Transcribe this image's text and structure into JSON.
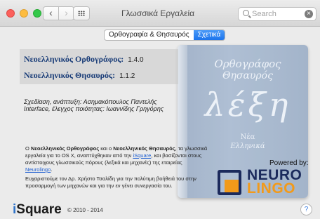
{
  "window": {
    "title": "Γλωσσικά Εργαλεία"
  },
  "search": {
    "placeholder": "Search"
  },
  "tabs": [
    {
      "label": "Ορθογραφία & Θησαυρός",
      "active": false
    },
    {
      "label": "Σχετικά",
      "active": true
    }
  ],
  "book": {
    "line1": "Ορθογράφος",
    "line2": "Θησαυρός",
    "word": "λέξη",
    "line4": "Νέα",
    "line5": "Ελληνικά"
  },
  "versions": [
    {
      "name": "Νεοελληνικός Ορθογράφος:",
      "version": "1.4.0"
    },
    {
      "name": "Νεοελληνικός Θησαυρός:",
      "version": "1.1.2"
    }
  ],
  "credits": {
    "design_label": "Σχεδίαση, ανάπτυξη:",
    "design_name": "Ασημακόπουλος Παντελής",
    "interface_label": "Interface, έλεγχος ποιότητας:",
    "interface_name": "Ιωαννίδης Γρηγόρης"
  },
  "description": {
    "p1": "Ο",
    "speller": "Νεοελληνικός Ορθογράφος",
    "p2": "και ο",
    "thesaurus": "Νεοελληνικός Θησαυρός",
    "p3": ", τα γλωσσικά εργαλεία για το OS X, αναπτύχθηκαν από την",
    "isquare_link": "iSquare",
    "p4": ", και βασίζονται στους αντίστοιχους γλωσσικούς πόρους (λεξικά και μηχανές) της εταιρείας",
    "neurolingo_link": "Neurolingo",
    "p5": "."
  },
  "thanks": "Ευχαριστούμε τον Δρ. Χρήστο Τσαλίδη για την πολύτιμη βοήθειά του στην προσαρμογή των μηχανών και για την εν γένει συνεργασία του.",
  "powered_by": "Powered by:",
  "neurolingo": {
    "top": "NEURO",
    "bottom": "LINGO"
  },
  "footer": {
    "logo_i": "i",
    "logo_rest": "Square",
    "copyright": "© 2010 - 2014"
  },
  "help": "?",
  "colors": {
    "accent": "#1c74ec",
    "title_blue": "#1a3d78",
    "link": "#1f5fd0",
    "brand_orange": "#f29a1a",
    "brand_navy": "#1b2a5c"
  }
}
